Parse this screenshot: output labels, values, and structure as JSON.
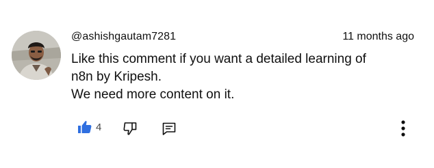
{
  "comment": {
    "author": "@ashishgautam7281",
    "timestamp": "11 months ago",
    "lines": [
      "Like this comment if you want a detailed learning of",
      "n8n by Kripesh.",
      "We need more content on it."
    ],
    "like_count": "4",
    "icons": {
      "like": "thumbs-up-icon",
      "dislike": "thumbs-down-icon",
      "reply": "reply-icon",
      "more": "more-vert-icon"
    },
    "colors": {
      "like_active": "#2f6fe0",
      "icon_outline": "#0f0f0f",
      "count_text": "#4a4a4a"
    }
  }
}
